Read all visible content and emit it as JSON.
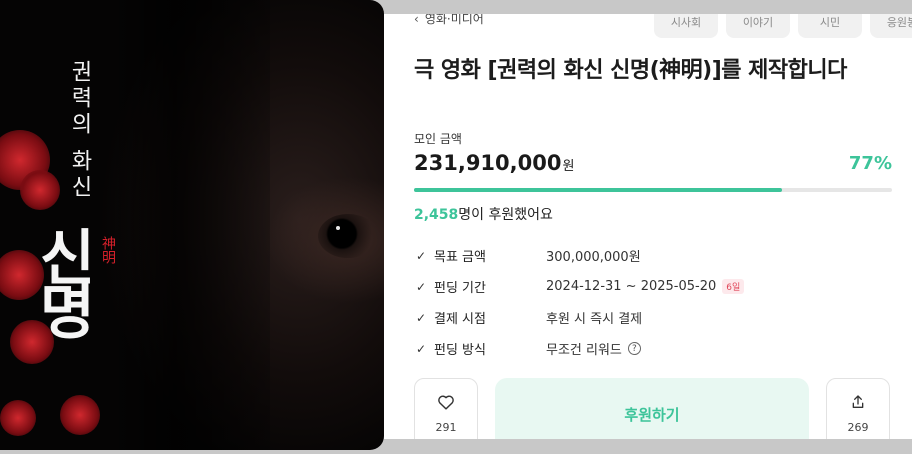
{
  "poster": {
    "title_vertical": "권력의 화신",
    "title_big": "신명",
    "title_hanja": "神明"
  },
  "breadcrumb": {
    "icon": "chevron-left-icon",
    "label": "영화·미디어"
  },
  "tabs": [
    {
      "label": "시사회"
    },
    {
      "label": "이야기"
    },
    {
      "label": "시민"
    },
    {
      "label": "응원봉"
    }
  ],
  "project": {
    "title": "극 영화 [권력의 화신 신명(神明)]를 제작합니다"
  },
  "funding": {
    "amount_label": "모인 금액",
    "amount": "231,910,000",
    "amount_unit": "원",
    "percent_text": "77%",
    "progress": 0.77,
    "supporters_count": "2,458",
    "supporters_suffix": "명이 후원했어요"
  },
  "info": [
    {
      "key": "목표 금액",
      "value": "300,000,000원"
    },
    {
      "key": "펀딩 기간",
      "value": "2024-12-31 ~ 2025-05-20",
      "badge": "6일"
    },
    {
      "key": "결제 시점",
      "value": "후원 시 즉시 결제"
    },
    {
      "key": "펀딩 방식",
      "value": "무조건 리워드",
      "help_icon": "question-icon"
    }
  ],
  "actions": {
    "like_count": "291",
    "like_icon": "heart-icon",
    "support_label": "후원하기",
    "share_count": "269",
    "share_icon": "share-icon"
  },
  "colors": {
    "accent": "#3dc49a",
    "badge": "#e0485a"
  }
}
